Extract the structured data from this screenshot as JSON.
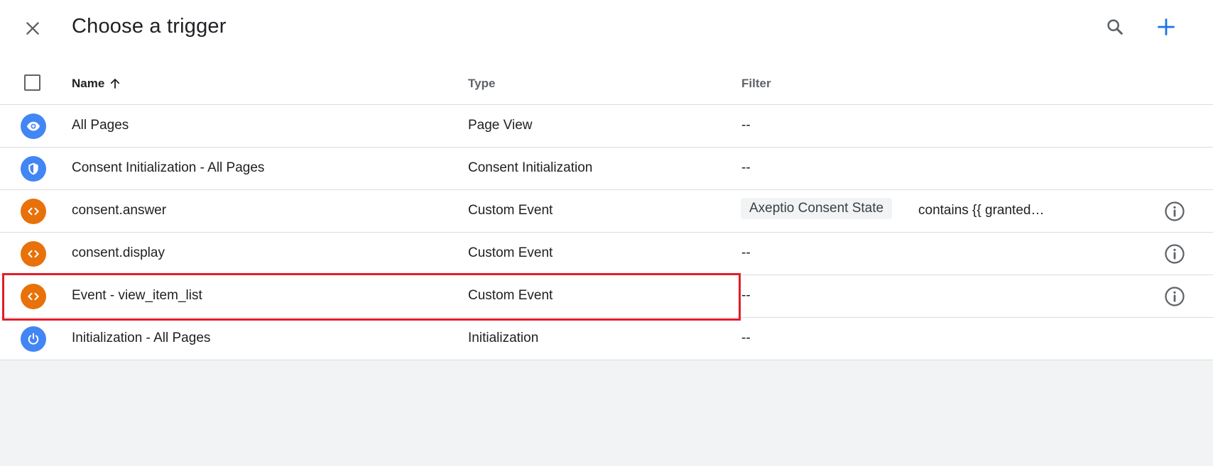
{
  "header": {
    "title": "Choose a trigger",
    "close_icon": "close-icon",
    "search_icon": "search-icon",
    "add_icon": "add-icon",
    "accent_color": "#1a73e8"
  },
  "table": {
    "columns": {
      "name": "Name",
      "type": "Type",
      "filter": "Filter"
    },
    "sort": {
      "column": "Name",
      "direction": "ascending",
      "icon": "arrow-up-icon"
    },
    "rows": [
      {
        "name": "All Pages",
        "type": "Page View",
        "filter": "--",
        "icon": "eye-icon",
        "icon_color": "#4285f4"
      },
      {
        "name": "Consent Initialization - All Pages",
        "type": "Consent Initialization",
        "filter": "--",
        "icon": "shield-icon",
        "icon_color": "#4285f4"
      },
      {
        "name": "consent.answer",
        "type": "Custom Event",
        "filter_chip": "Axeptio Consent State",
        "filter": "contains {{ granted…",
        "icon": "code-icon",
        "icon_color": "#e8710a",
        "has_info": true
      },
      {
        "name": "consent.display",
        "type": "Custom Event",
        "filter": "--",
        "icon": "code-icon",
        "icon_color": "#e8710a",
        "has_info": true
      },
      {
        "name": "Event - view_item_list",
        "type": "Custom Event",
        "filter": "--",
        "icon": "code-icon",
        "icon_color": "#e8710a",
        "has_info": true,
        "highlighted": true
      },
      {
        "name": "Initialization - All Pages",
        "type": "Initialization",
        "filter": "--",
        "icon": "power-icon",
        "icon_color": "#4285f4"
      }
    ]
  },
  "highlight_color": "#e11d2a"
}
